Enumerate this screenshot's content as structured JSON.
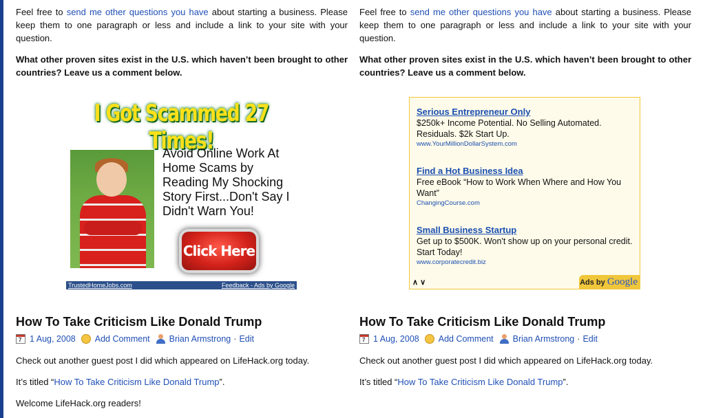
{
  "columns": [
    {
      "intro": {
        "before_link": "Feel free to ",
        "link": "send me other questions you have",
        "after_link": " about starting a business. Please keep them to one paragraph or less and include a link to your site with your question."
      },
      "question": "What other proven sites exist in the U.S. which haven’t been brought to other countries? Leave us a comment below.",
      "post": {
        "title": "How To Take Criticism Like Donald Trump",
        "date": "1 Aug, 2008",
        "comment_link": "Add Comment",
        "author": "Brian Armstrong",
        "separator": "·",
        "edit": "Edit",
        "para1": "Check out another guest post I did which appeared on LifeHack.org today.",
        "titled_before": "It’s titled “",
        "titled_link": "How To Take Criticism Like Donald Trump",
        "titled_after": "”.",
        "para3": "Welcome LifeHack.org readers!"
      }
    },
    {
      "intro": {
        "before_link": "Feel free to ",
        "link": "send me other questions you have",
        "after_link": " about starting a business. Please keep them to one paragraph or less and include a link to your site with your question."
      },
      "question": "What other proven sites exist in the U.S. which haven’t been brought to other countries? Leave us a comment below.",
      "post": {
        "title": "How To Take Criticism Like Donald Trump",
        "date": "1 Aug, 2008",
        "comment_link": "Add Comment",
        "author": "Brian Armstrong",
        "separator": "·",
        "edit": "Edit",
        "para1": "Check out another guest post I did which appeared on LifeHack.org today.",
        "titled_before": "It’s titled “",
        "titled_link": "How To Take Criticism Like Donald Trump",
        "titled_after": "”."
      }
    }
  ],
  "image_ad": {
    "headline": "I Got Scammed 27 Times!",
    "copy": "Avoid Online Work At Home Scams by Reading My Shocking Story First...Don't Say I Didn't Warn You!",
    "button": "Click Here",
    "site": "TrustedHomeJobs.com",
    "feedback": "Feedback - Ads by Google"
  },
  "text_ad": {
    "units": [
      {
        "title": "Serious Entrepreneur Only",
        "desc": "$250k+ Income Potential. No Selling Automated. Residuals. $2k Start Up.",
        "url": "www.YourMillionDollarSystem.com"
      },
      {
        "title": "Find a Hot Business Idea",
        "desc": "Free eBook “How to Work When Where and How You Want”",
        "url": "ChangingCourse.com"
      },
      {
        "title": "Small Business Startup",
        "desc": "Get up to $500K. Won't show up on your personal credit. Start Today!",
        "url": "www.corporatecredit.biz"
      }
    ],
    "adchoice": "∧ ∨",
    "ads_by": "Ads by ",
    "google": "Google"
  },
  "icons": {
    "calendar": "calendar-icon",
    "comment": "comment-bubble-icon",
    "author": "user-icon",
    "calendar_day": "7"
  },
  "colors": {
    "link": "#1f4fb5",
    "left_bar": "#1a3f8f",
    "ad_border": "#f0c63a",
    "ad_background": "#fffbea"
  }
}
